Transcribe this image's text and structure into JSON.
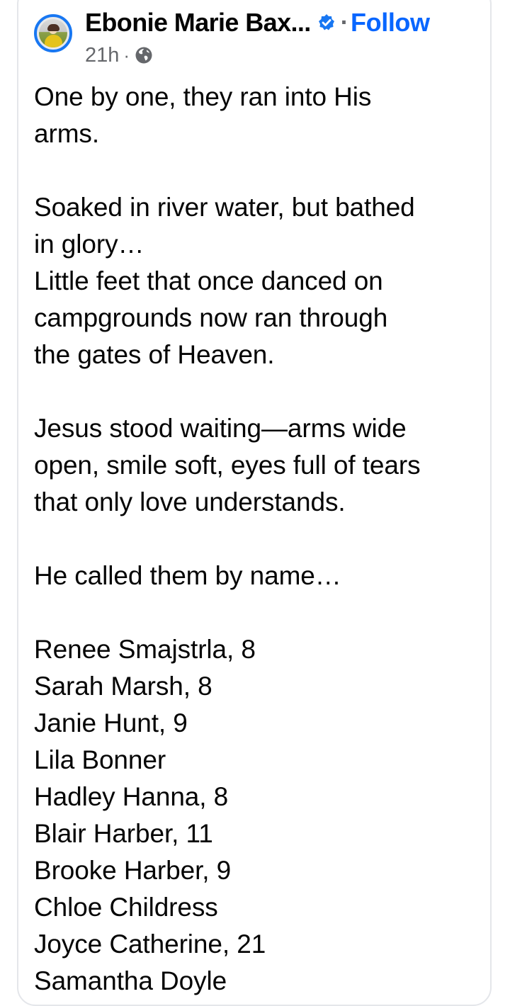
{
  "post": {
    "author": {
      "name": "Ebonie Marie Bax...",
      "verified_icon": "verified-badge-icon",
      "avatar_icon": "profile-avatar"
    },
    "follow_label": "Follow",
    "separator": "·",
    "timestamp": "21h",
    "audience_icon": "globe-icon",
    "colors": {
      "accent": "#0866ff",
      "meta_text": "#65676b",
      "avatar_ring": "#1877f2",
      "body_text": "#050505",
      "card_border": "#e4e6ea"
    },
    "paragraph1": [
      "One by one, they ran into His",
      "arms."
    ],
    "paragraph2": [
      "Soaked in river water, but bathed",
      "in glory…",
      "Little feet that once danced on",
      "campgrounds now ran through",
      "the gates of Heaven."
    ],
    "paragraph3": [
      "Jesus stood waiting—arms wide",
      "open, smile soft, eyes full of tears",
      "that only love understands."
    ],
    "paragraph4": [
      "He called them by name…"
    ],
    "names": [
      "Renee Smajstrla, 8",
      "Sarah Marsh, 8",
      "Janie Hunt, 9",
      "Lila Bonner",
      "Hadley Hanna, 8",
      "Blair Harber, 11",
      "Brooke Harber, 9",
      "Chloe Childress",
      "Joyce Catherine, 21",
      "Samantha Doyle"
    ]
  }
}
